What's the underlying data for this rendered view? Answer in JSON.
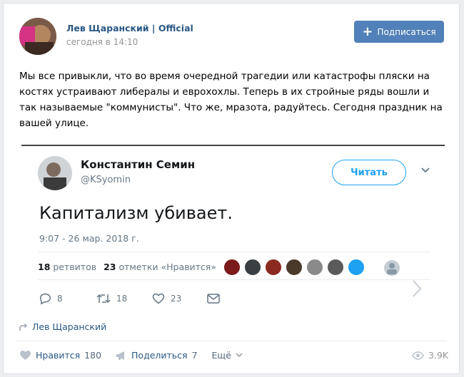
{
  "post": {
    "author": "Лев Щаранский | Official",
    "time": "сегодня в 14:10",
    "subscribe_label": "Подписаться",
    "text": "Мы все привыкли, что во время очередной трагедии или катастрофы пляски на костях устраивают либералы и еврохохлы. Теперь в их стройные ряды вошли и так называемые \"коммунисты\". Что же, мразота, радуйтесь. Сегодня праздник на вашей улице."
  },
  "tweet": {
    "name": "Константин Семин",
    "handle": "@KSyomin",
    "follow_label": "Читать",
    "text": "Капитализм убивает.",
    "date": "9:07 - 26 мар. 2018 г.",
    "retweets_count": "18",
    "retweets_label": "ретвитов",
    "likes_count": "23",
    "likes_label": "отметки «Нравится»",
    "reply_count": "8",
    "retweet_count": "18",
    "like_count": "23",
    "liker_colors": [
      "#7a1a1a",
      "#3a3f44",
      "#8c2a22",
      "#4a3a2a",
      "#8a8a8a",
      "#5a5a5a",
      "#1da1f2"
    ]
  },
  "repost_source": "Лев Щаранский",
  "footer": {
    "like_label": "Нравится",
    "like_count": "180",
    "share_label": "Поделиться",
    "share_count": "7",
    "more_label": "Ещё",
    "views": "3.9K"
  },
  "colors": {
    "link": "#2a5885",
    "button": "#5181b8",
    "twitter": "#1da1f2"
  }
}
